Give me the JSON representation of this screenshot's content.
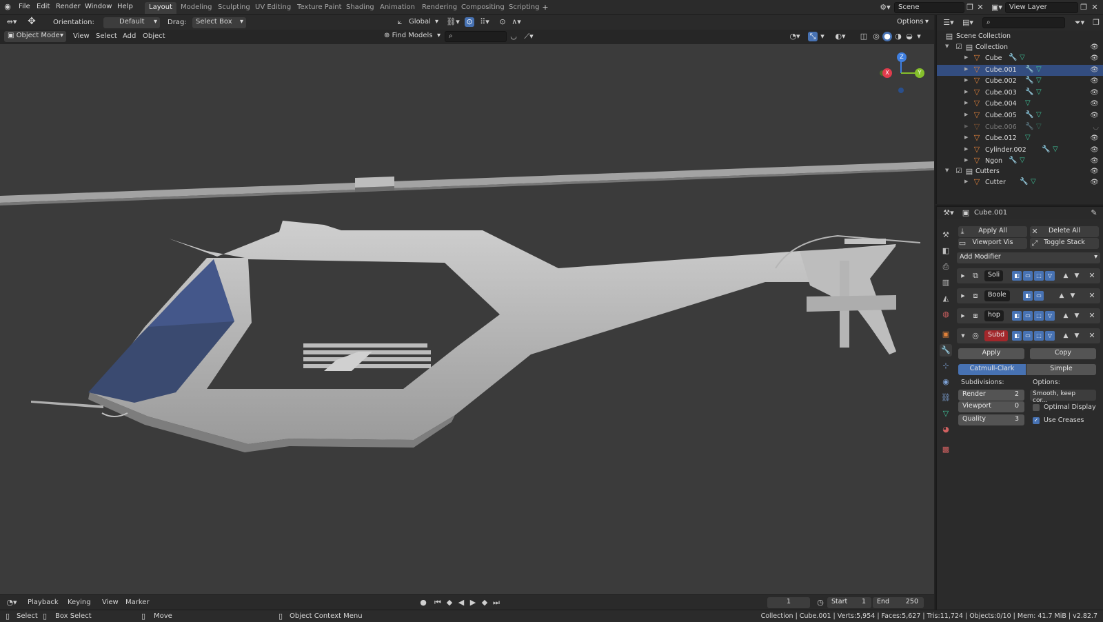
{
  "menu": [
    "File",
    "Edit",
    "Render",
    "Window",
    "Help"
  ],
  "workspaces": [
    "Layout",
    "Modeling",
    "Sculpting",
    "UV Editing",
    "Texture Paint",
    "Shading",
    "Animation",
    "Rendering",
    "Compositing",
    "Scripting"
  ],
  "active_workspace": "Layout",
  "scene": {
    "name": "Scene",
    "view_layer": "View Layer"
  },
  "header": {
    "orientation_label": "Orientation:",
    "orientation_value": "Default",
    "drag_label": "Drag:",
    "drag_value": "Select Box",
    "transform_orientation": "Global",
    "options_label": "Options"
  },
  "viewport_header": {
    "mode": "Object Mode",
    "menus": [
      "View",
      "Select",
      "Add",
      "Object"
    ],
    "find_models": "Find Models"
  },
  "gizmo": {
    "z": "Z",
    "x": "X",
    "y": "Y"
  },
  "outliner": {
    "scene_collection": "Scene Collection",
    "collection": "Collection",
    "items": [
      {
        "name": "Cube",
        "wrench": true,
        "dim": false
      },
      {
        "name": "Cube.001",
        "wrench": true,
        "dim": false
      },
      {
        "name": "Cube.002",
        "wrench": true,
        "dim": false
      },
      {
        "name": "Cube.003",
        "wrench": true,
        "dim": false
      },
      {
        "name": "Cube.004",
        "wrench": false,
        "dim": false
      },
      {
        "name": "Cube.005",
        "wrench": true,
        "dim": false
      },
      {
        "name": "Cube.006",
        "wrench": true,
        "dim": true
      },
      {
        "name": "Cube.012",
        "wrench": false,
        "dim": false
      },
      {
        "name": "Cylinder.002",
        "wrench": true,
        "dim": false
      },
      {
        "name": "Ngon",
        "wrench": true,
        "dim": false
      }
    ],
    "cutters": "Cutters",
    "cutter_items": [
      {
        "name": "Cutter",
        "wrench": true
      }
    ]
  },
  "properties": {
    "object_name": "Cube.001",
    "apply_all": "Apply All",
    "delete_all": "Delete All",
    "viewport_vis": "Viewport Vis",
    "toggle_stack": "Toggle Stack",
    "add_modifier": "Add Modifier",
    "modifiers": [
      {
        "name": "Soli",
        "active": false
      },
      {
        "name": "Boole",
        "active": false
      },
      {
        "name": "hop",
        "active": false
      },
      {
        "name": "Subd",
        "active": true
      }
    ],
    "apply": "Apply",
    "copy": "Copy",
    "catmull": "Catmull-Clark",
    "simple": "Simple",
    "subdivisions_label": "Subdivisions:",
    "options_label": "Options:",
    "render_label": "Render",
    "render_value": "2",
    "viewport_label": "Viewport",
    "viewport_value": "0",
    "quality_label": "Quality",
    "quality_value": "3",
    "smooth_option": "Smooth, keep cor...",
    "optimal_display": "Optimal Display",
    "optimal_display_checked": false,
    "use_creases": "Use Creases",
    "use_creases_checked": true
  },
  "timeline": {
    "menus": [
      "Playback",
      "Keying",
      "View",
      "Marker"
    ],
    "current_frame": "1",
    "start_label": "Start",
    "start_value": "1",
    "end_label": "End",
    "end_value": "250"
  },
  "status": {
    "select": "Select",
    "box_select": "Box Select",
    "move": "Move",
    "context_menu": "Object Context Menu",
    "stats": "Collection | Cube.001 | Verts:5,954 | Faces:5,627 | Tris:11,724 | Objects:0/10 | Mem: 41.7 MiB | v2.82.7"
  },
  "colors": {
    "accent": "#4772b3",
    "object_orange": "#e0813a",
    "mesh_green": "#3fc39a",
    "active_mod_red": "#a3272b",
    "viewport_bg": "#3b3b3b"
  }
}
